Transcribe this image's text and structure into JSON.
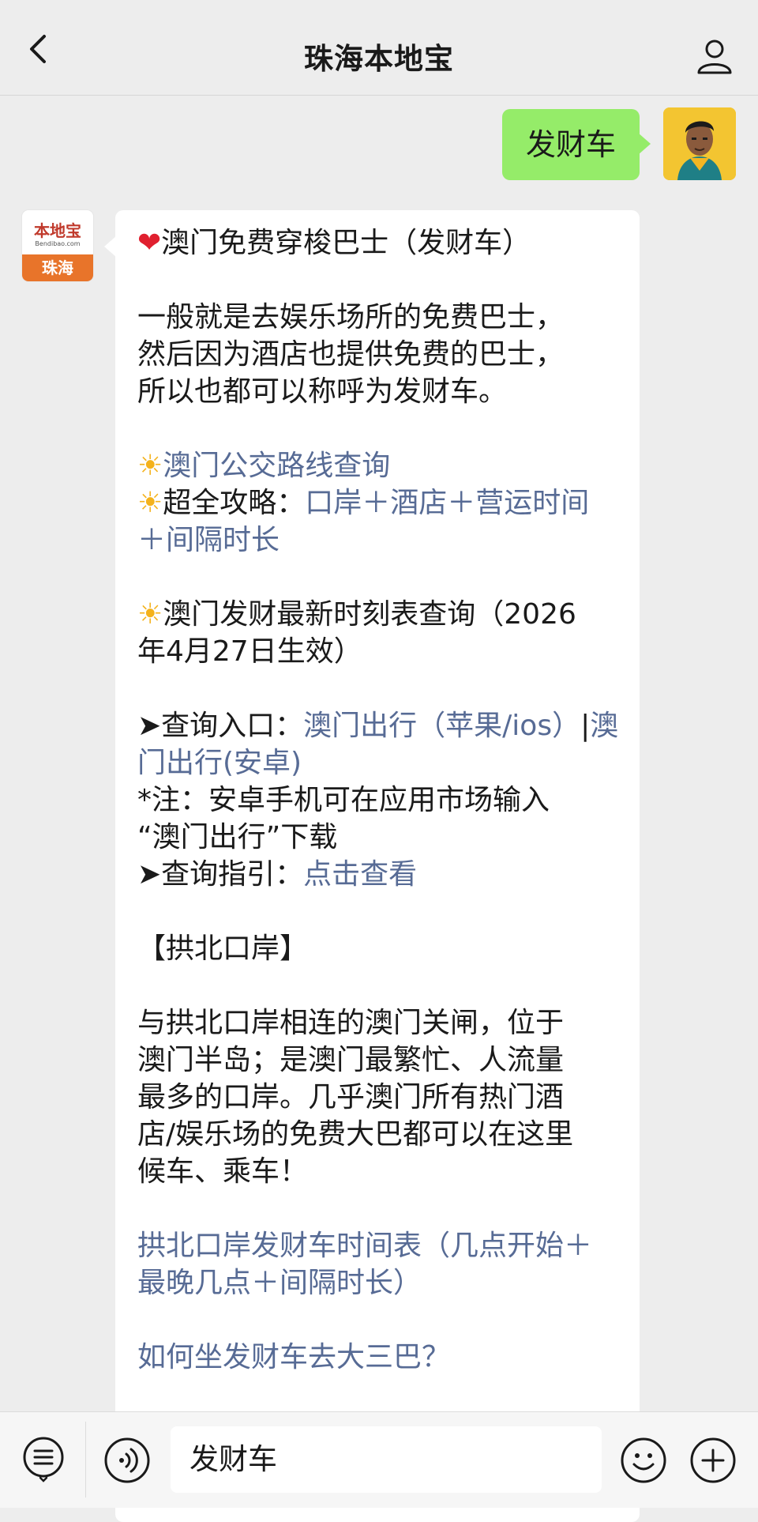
{
  "header": {
    "title": "珠海本地宝",
    "back_icon": "chevron-left-icon",
    "profile_icon": "user-icon"
  },
  "chat": {
    "sent_message": "发财车",
    "bot_avatar": {
      "logo_top": "本地宝",
      "logo_small": "Bendibao.com",
      "logo_bottom": "珠海"
    },
    "reply": {
      "title": "澳门免费穿梭巴士（发财车）",
      "intro_1": "一般就是去娱乐场所的免费巴士，",
      "intro_2": "然后因为酒店也提供免费的巴士，",
      "intro_3": "所以也都可以称呼为发财车。",
      "link_bus_query": "澳门公交路线查询",
      "guide_label": "超全攻略：",
      "guide_link_1": "口岸＋酒店＋营运时间",
      "guide_link_2": "＋间隔时长",
      "schedule_1": "澳门发财最新时刻表查询（2026",
      "schedule_2": "年4月27日生效）",
      "entry_label": "➤查询入口：",
      "entry_link_1a": "澳门出行（苹果/ios）",
      "entry_sep": "|",
      "entry_link_1b": "澳",
      "entry_link_2": "门出行(安卓)",
      "note_1": "*注：安卓手机可在应用市场输入",
      "note_2": "“澳门出行”下载",
      "guide2_label": "➤查询指引：",
      "guide2_link": "点击查看",
      "section_title": "【拱北口岸】",
      "desc_1": "与拱北口岸相连的澳门关闸，位于",
      "desc_2": "澳门半岛；是澳门最繁忙、人流量",
      "desc_3": "最多的口岸。几乎澳门所有热门酒",
      "desc_4": "店/娱乐场的免费大巴都可以在这里",
      "desc_5": "候车、乘车！",
      "timetable_link_1": "拱北口岸发财车时间表（几点开始＋",
      "timetable_link_2": "最晚几点＋间隔时长）",
      "sanba_link": "如何坐发财车去大三巴？"
    }
  },
  "input_bar": {
    "input_value": "发财车",
    "menu_icon": "menu-list-icon",
    "voice_icon": "voice-icon",
    "emoji_icon": "emoji-icon",
    "plus_icon": "plus-icon"
  },
  "colors": {
    "background": "#ededed",
    "sent_bubble": "#95ec69",
    "link": "#576b95",
    "heart": "#e0202f",
    "sun": "#f4b21c"
  }
}
